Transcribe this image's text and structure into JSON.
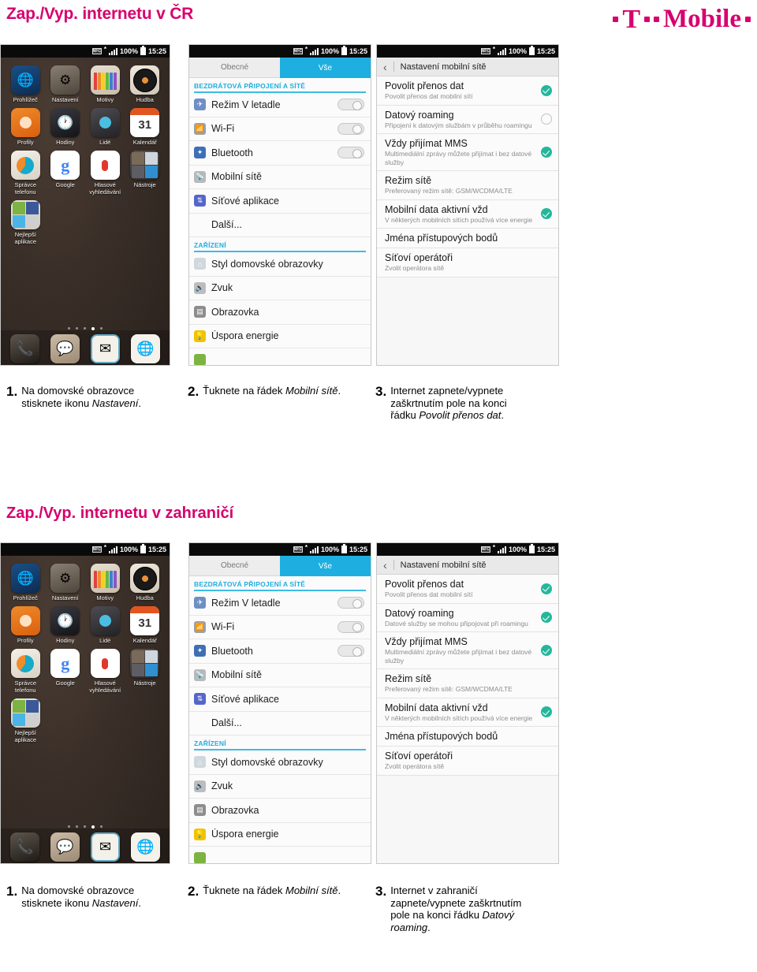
{
  "header": {
    "title": "Zap./Vyp. internetu v ČR",
    "logo": {
      "t": "T",
      "word": "Mobile"
    }
  },
  "section2": {
    "title": "Zap./Vyp. internetu v zahraničí"
  },
  "colors": {
    "brand_magenta": "#d6006e",
    "tab_accent": "#1eaee0",
    "check_green": "#25b79b"
  },
  "statusbar": {
    "nfc_icon": "nfc-icon",
    "asterisk": "*",
    "signal_icon": "signal-bars-icon",
    "battery_pct": "100%",
    "battery_icon": "battery-full-icon",
    "time": "15:25"
  },
  "home_screen": {
    "apps": [
      {
        "label": "Prohlížeč",
        "icon": "browser-icon"
      },
      {
        "label": "Nastavení",
        "icon": "settings-gear-icon"
      },
      {
        "label": "Motivy",
        "icon": "themes-pencils-icon"
      },
      {
        "label": "Hudba",
        "icon": "music-vinyl-icon"
      },
      {
        "label": "Profily",
        "icon": "profiles-person-icon"
      },
      {
        "label": "Hodiny",
        "icon": "clock-icon"
      },
      {
        "label": "Lidé",
        "icon": "people-contacts-icon"
      },
      {
        "label": "Kalendář",
        "icon": "calendar-icon",
        "badge": "31"
      },
      {
        "label": "Správce telefonu",
        "icon": "phone-manager-gauge-icon"
      },
      {
        "label": "Google",
        "icon": "google-g-icon"
      },
      {
        "label": "Hlasové vyhledávání",
        "icon": "voice-search-mic-icon"
      },
      {
        "label": "Nástroje",
        "icon": "tools-folder-icon"
      },
      {
        "label": "Nejlepší aplikace",
        "icon": "best-apps-folder-icon"
      }
    ],
    "page_dots": {
      "count": 5,
      "active_index": 3
    },
    "dock": [
      {
        "icon": "phone-dialer-icon"
      },
      {
        "icon": "messages-bubble-icon"
      },
      {
        "icon": "email-envelope-icon"
      },
      {
        "icon": "browser-globe-icon"
      }
    ]
  },
  "settings_screen": {
    "tabs": [
      {
        "label": "Obecné",
        "active": false
      },
      {
        "label": "Vše",
        "active": true
      }
    ],
    "groups": [
      {
        "header": "BEZDRÁTOVÁ PŘIPOJENÍ A SÍTĚ",
        "rows": [
          {
            "label": "Režim V letadle",
            "icon": "airplane-mode-icon",
            "toggle": "off"
          },
          {
            "label": "Wi-Fi",
            "icon": "wifi-icon",
            "toggle": "off"
          },
          {
            "label": "Bluetooth",
            "icon": "bluetooth-icon",
            "toggle": "off"
          },
          {
            "label": "Mobilní sítě",
            "icon": "mobile-networks-icon"
          },
          {
            "label": "Síťové aplikace",
            "icon": "network-apps-icon"
          },
          {
            "label": "Další...",
            "icon": ""
          }
        ]
      },
      {
        "header": "ZAŘÍZENÍ",
        "rows": [
          {
            "label": "Styl domovské obrazovky",
            "icon": "home-style-icon"
          },
          {
            "label": "Zvuk",
            "icon": "sound-icon"
          },
          {
            "label": "Obrazovka",
            "icon": "display-icon"
          },
          {
            "label": "Úspora energie",
            "icon": "battery-saver-icon"
          },
          {
            "label": "",
            "icon": "cut-off-row-icon"
          }
        ]
      }
    ]
  },
  "network_screen_cz": {
    "back_icon": "back-chevron-icon",
    "title": "Nastavení mobilní sítě",
    "rows": [
      {
        "title": "Povolit přenos dat",
        "sub": "Povolit přenos dat mobilní sítí",
        "check": "on"
      },
      {
        "title": "Datový roaming",
        "sub": "Připojení k datovým službám v průběhu roamingu",
        "check": "off"
      },
      {
        "title": "Vždy přijímat MMS",
        "sub": "Multimediální zprávy můžete přijímat i bez datové služby",
        "check": "on"
      },
      {
        "title": "Režim sítě",
        "sub": "Preferovaný režim sítě: GSM/WCDMA/LTE",
        "check": "none"
      },
      {
        "title": "Mobilní data aktivní vžd",
        "sub": "V některých mobilních sítích používá více energie",
        "check": "on"
      },
      {
        "title": "Jména přístupových bodů",
        "sub": "",
        "check": "none"
      },
      {
        "title": "Síťoví operátoři",
        "sub": "Zvolit operátora sítě",
        "check": "none"
      }
    ]
  },
  "network_screen_roaming": {
    "back_icon": "back-chevron-icon",
    "title": "Nastavení mobilní sítě",
    "rows": [
      {
        "title": "Povolit přenos dat",
        "sub": "Povolit přenos dat mobilní sítí",
        "check": "on"
      },
      {
        "title": "Datový roaming",
        "sub": "Datové služby se mohou připojovat při roamingu",
        "check": "on"
      },
      {
        "title": "Vždy přijímat MMS",
        "sub": "Multimediální zprávy můžete přijímat i bez datové služby",
        "check": "on"
      },
      {
        "title": "Režim sítě",
        "sub": "Preferovaný režim sítě: GSM/WCDMA/LTE",
        "check": "none"
      },
      {
        "title": "Mobilní data aktivní vžd",
        "sub": "V některých mobilních sítích používá více energie",
        "check": "on"
      },
      {
        "title": "Jména přístupových bodů",
        "sub": "",
        "check": "none"
      },
      {
        "title": "Síťoví operátoři",
        "sub": "Zvolit operátora sítě",
        "check": "none"
      }
    ]
  },
  "steps_cz": [
    {
      "num": "1.",
      "lead": "Na domovské obrazovce stisknete ikonu ",
      "em": "Nastavení",
      "tail": "."
    },
    {
      "num": "2.",
      "lead": "Ťuknete na řádek ",
      "em": "Mobilní sítě",
      "tail": "."
    },
    {
      "num": "3.",
      "lead": "Internet zapnete/vypnete zaškrtnutím pole na konci řádku ",
      "em": "Povolit přenos dat",
      "tail": "."
    }
  ],
  "steps_roaming": [
    {
      "num": "1.",
      "lead": "Na domovské obrazovce stisknete ikonu ",
      "em": "Nastavení",
      "tail": "."
    },
    {
      "num": "2.",
      "lead": "Ťuknete na řádek ",
      "em": "Mobilní sítě",
      "tail": "."
    },
    {
      "num": "3.",
      "lead": "Internet v zahraničí zapnete/vypnete zaškrtnutím pole na konci řádku ",
      "em": "Datový roaming",
      "tail": "."
    }
  ]
}
